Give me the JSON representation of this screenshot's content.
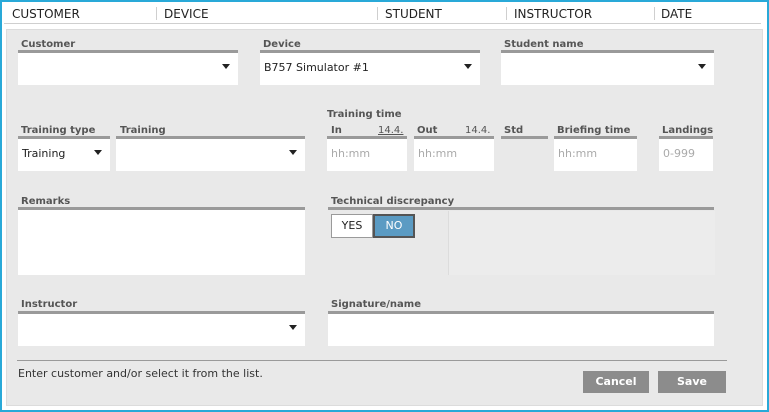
{
  "columns": {
    "customer": "CUSTOMER",
    "device": "DEVICE",
    "student": "STUDENT",
    "instructor": "INSTRUCTOR",
    "date": "DATE"
  },
  "form": {
    "customer": {
      "label": "Customer",
      "value": ""
    },
    "device": {
      "label": "Device",
      "value": "B757 Simulator #1"
    },
    "student": {
      "label": "Student name",
      "value": ""
    },
    "training_type": {
      "label": "Training type",
      "value": "Training"
    },
    "training": {
      "label": "Training",
      "value": ""
    },
    "training_time": {
      "label": "Training time",
      "in_label": "In",
      "in_date": "14.4.",
      "in_placeholder": "hh:mm",
      "out_label": "Out",
      "out_date": "14.4.",
      "out_placeholder": "hh:mm",
      "std_label": "Std"
    },
    "briefing": {
      "label": "Briefing time",
      "placeholder": "hh:mm"
    },
    "landings": {
      "label": "Landings",
      "placeholder": "0-999"
    },
    "remarks": {
      "label": "Remarks"
    },
    "tech_discrepancy": {
      "label": "Technical discrepancy",
      "yes": "YES",
      "no": "NO",
      "selected": "NO"
    },
    "instructor": {
      "label": "Instructor",
      "value": ""
    },
    "signature": {
      "label": "Signature/name",
      "value": ""
    }
  },
  "footer": {
    "hint": "Enter customer and/or select it from the list.",
    "cancel": "Cancel",
    "save": "Save"
  },
  "colors": {
    "frame": "#29a9d8",
    "toggle_active": "#5b9bc3",
    "button": "#8c8c8c"
  }
}
